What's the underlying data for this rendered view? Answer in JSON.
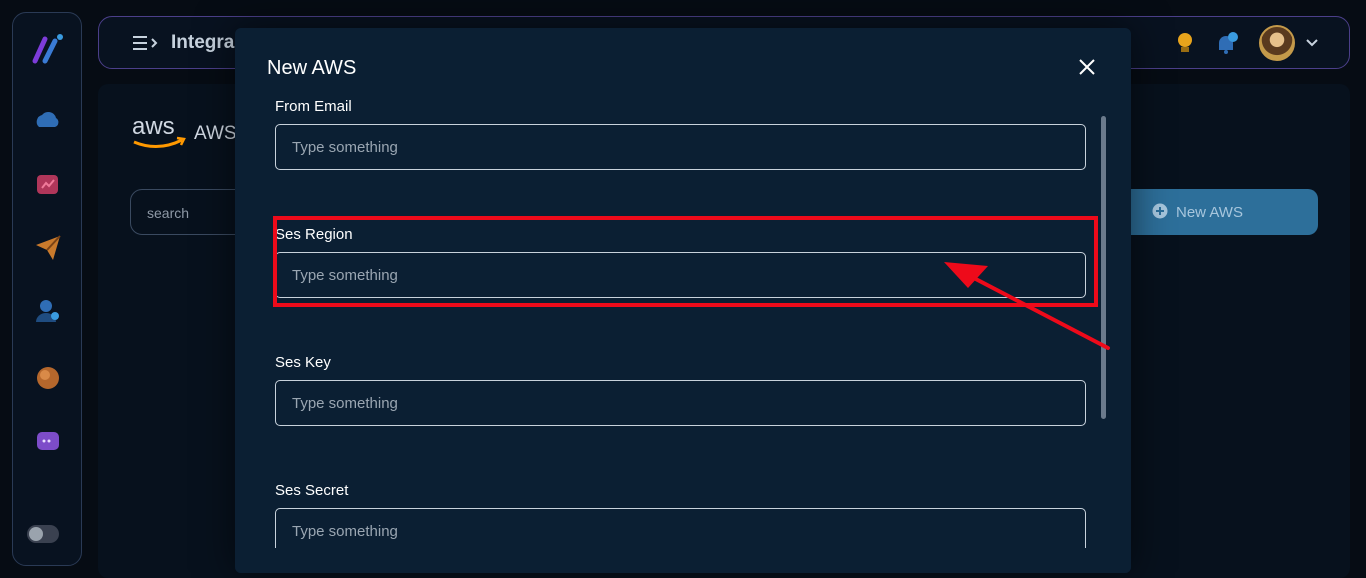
{
  "header": {
    "title": "Integra",
    "icons": [
      "hamburger-icon",
      "bulb-icon",
      "bell-icon",
      "avatar",
      "chevron-down-icon"
    ]
  },
  "sidebar": {
    "icons": [
      "app-logo",
      "cloud-icon",
      "chart-icon",
      "send-icon",
      "user-icon",
      "circle-icon",
      "chat-icon",
      "theme-toggle"
    ]
  },
  "page": {
    "aws_label": "AWS",
    "search_placeholder": "search",
    "new_button_label": "New AWS"
  },
  "modal": {
    "title": "New AWS",
    "fields": [
      {
        "label": "From Email",
        "placeholder": "Type something",
        "value": ""
      },
      {
        "label": "Ses Region",
        "placeholder": "Type something",
        "value": ""
      },
      {
        "label": "Ses Key",
        "placeholder": "Type something",
        "value": ""
      },
      {
        "label": "Ses Secret",
        "placeholder": "Type something",
        "value": ""
      }
    ]
  },
  "colors": {
    "background": "#060c14",
    "modal_bg": "#0b1f33",
    "accent_button": "#2d6f9a",
    "annotation_red": "#ee0a1a"
  }
}
